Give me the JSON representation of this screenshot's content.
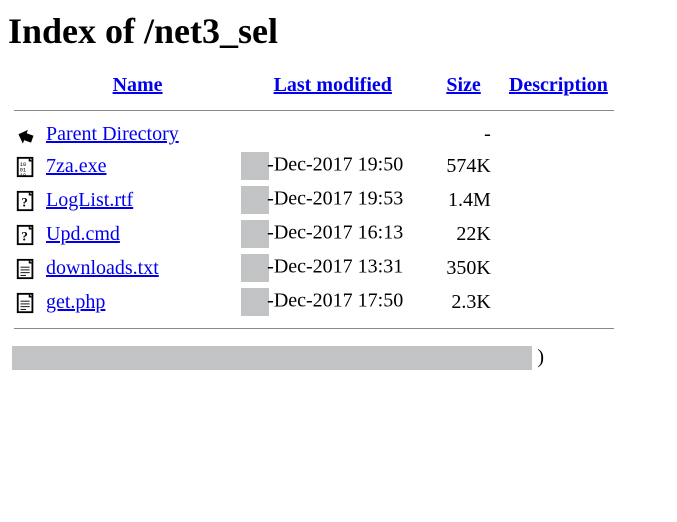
{
  "title": "Index of /net3_sel",
  "headers": {
    "name": "Name",
    "modified": "Last modified",
    "size": "Size",
    "description": "Description"
  },
  "parent": {
    "label": "Parent Directory",
    "size": "-"
  },
  "files": [
    {
      "name": "7za.exe",
      "modified": "-Dec-2017 19:50",
      "size": "574K",
      "icon": "binary"
    },
    {
      "name": "LogList.rtf",
      "modified": "-Dec-2017 19:53",
      "size": "1.4M",
      "icon": "unknown"
    },
    {
      "name": "Upd.cmd",
      "modified": "-Dec-2017 16:13",
      "size": "22K",
      "icon": "unknown"
    },
    {
      "name": "downloads.txt",
      "modified": "-Dec-2017 13:31",
      "size": "350K",
      "icon": "text"
    },
    {
      "name": "get.php",
      "modified": "-Dec-2017 17:50",
      "size": "2.3K",
      "icon": "text"
    }
  ],
  "footer_peek": ")"
}
